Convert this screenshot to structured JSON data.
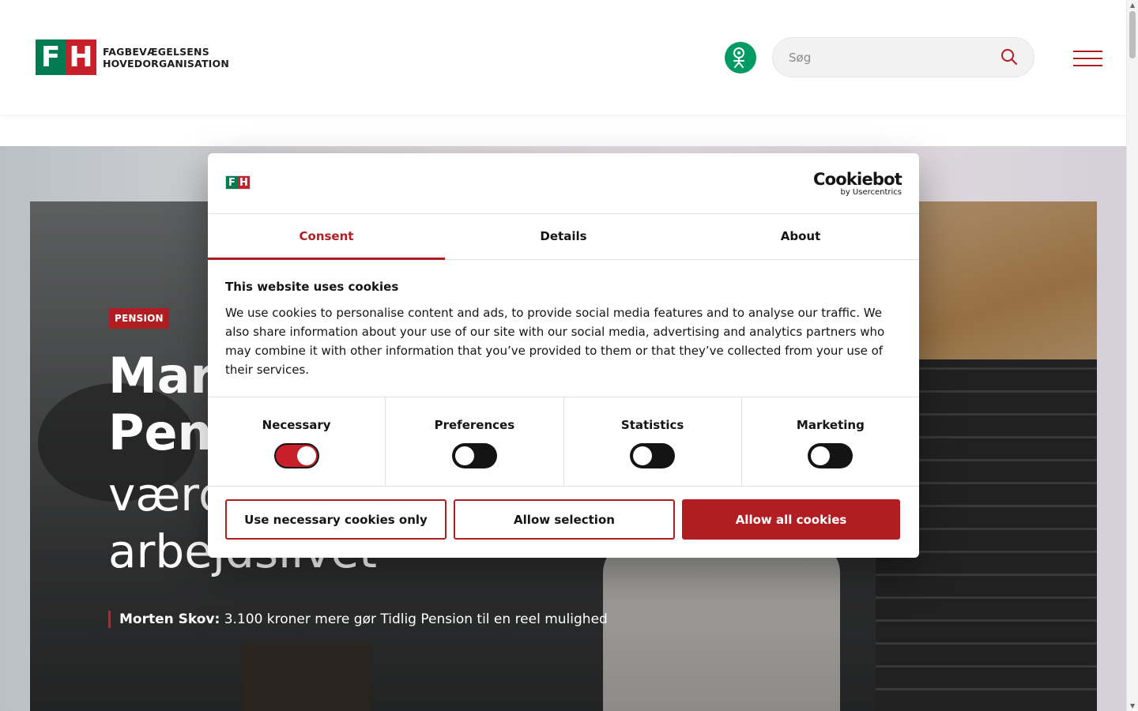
{
  "header": {
    "logo_letters": [
      "F",
      "H"
    ],
    "logo_line1": "FAGBEVÆGELSENS",
    "logo_line2": "HOVEDORGANISATION",
    "search_placeholder": "Søg",
    "accent_color": "#b01e23",
    "green_color": "#009a64"
  },
  "hero": {
    "badge": "PENSION",
    "title_line1": "Mark",
    "title_line2": "Pens",
    "sub_line1": "værd",
    "sub_line2": "arbejdslivet",
    "teaser_author": "Morten Skov:",
    "teaser_text": " 3.100 kroner mere gør Tidlig Pension til en reel mulighed"
  },
  "cookie_dialog": {
    "logo_letters": [
      "F",
      "H"
    ],
    "brand_name": "Cookiebot",
    "brand_by": "by Usercentrics",
    "tabs": [
      {
        "label": "Consent",
        "active": true
      },
      {
        "label": "Details",
        "active": false
      },
      {
        "label": "About",
        "active": false
      }
    ],
    "heading": "This website uses cookies",
    "body": "We use cookies to personalise content and ads, to provide social media features and to analyse our traffic. We also share information about your use of our site with our social media, advertising and analytics partners who may combine it with other information that you’ve provided to them or that they’ve collected from your use of their services.",
    "categories": [
      {
        "label": "Necessary",
        "enabled": true
      },
      {
        "label": "Preferences",
        "enabled": false
      },
      {
        "label": "Statistics",
        "enabled": false
      },
      {
        "label": "Marketing",
        "enabled": false
      }
    ],
    "buttons": {
      "necessary_only": "Use necessary cookies only",
      "allow_selection": "Allow selection",
      "allow_all": "Allow all cookies"
    }
  }
}
